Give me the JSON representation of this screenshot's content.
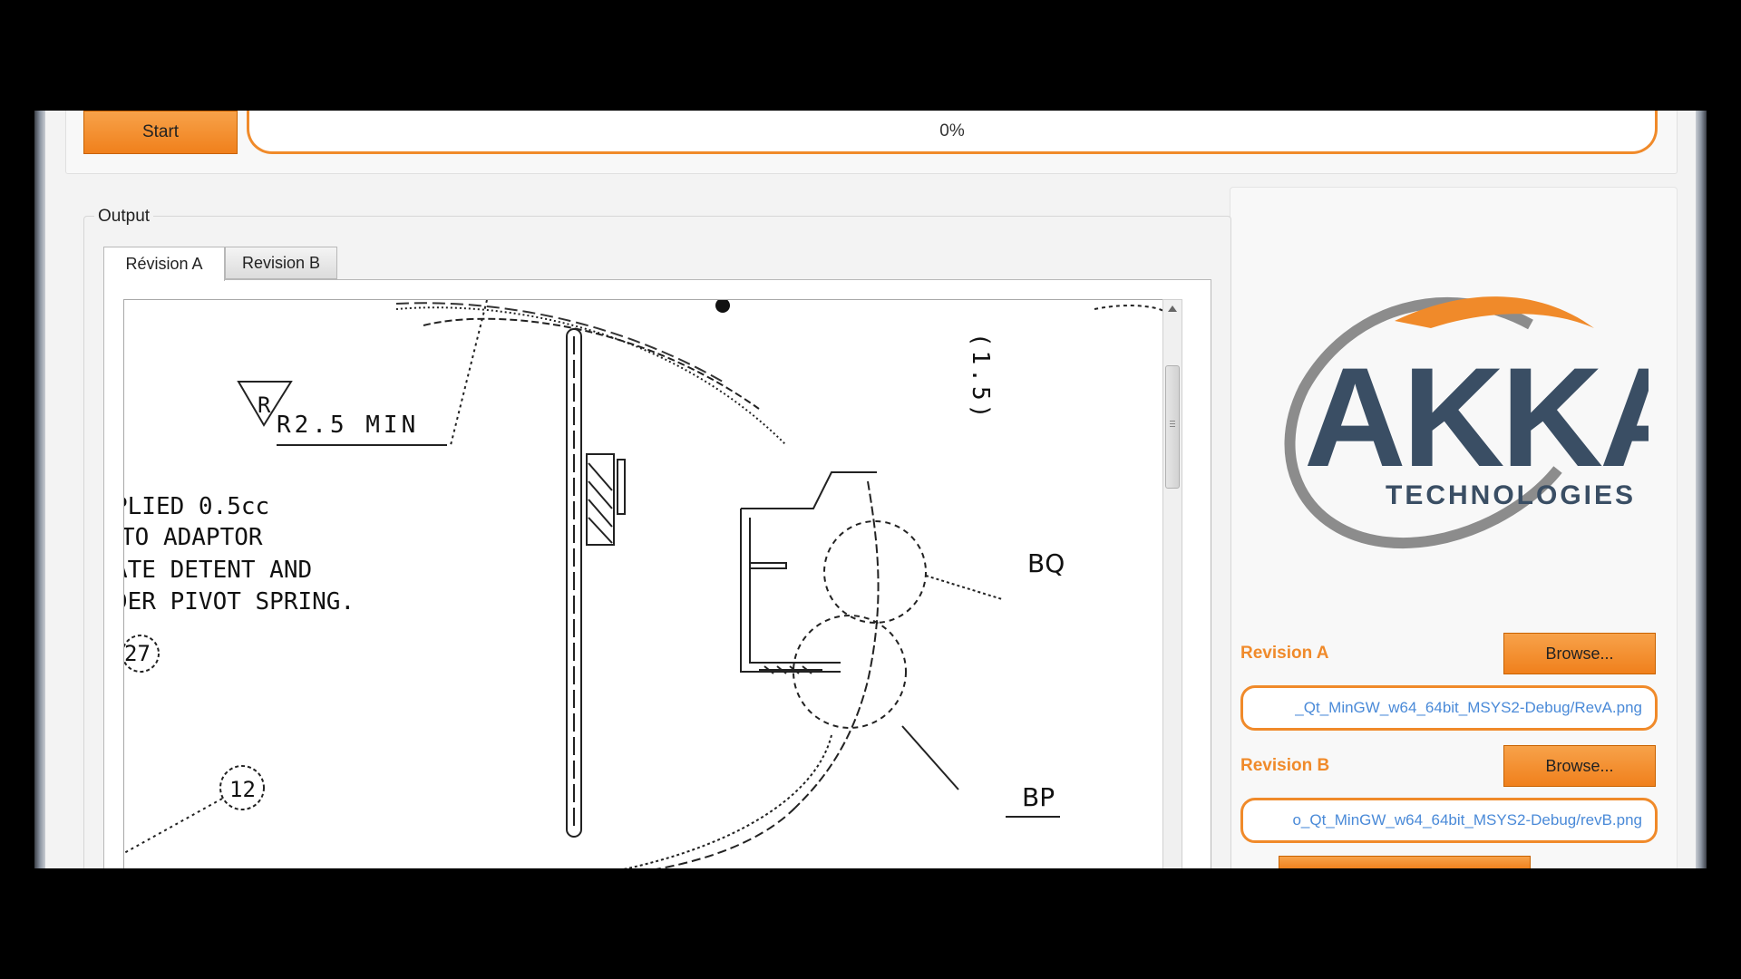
{
  "toolbar": {
    "start_label": "Start",
    "progress_text": "0%",
    "progress_value": 0
  },
  "output": {
    "title": "Output",
    "tabs": [
      {
        "label": "Révision A",
        "selected": true
      },
      {
        "label": "Revision B",
        "selected": false
      }
    ],
    "drawing_text": {
      "r_symbol": "R",
      "min_label": "R2.5 MIN",
      "note_line1": "PLIED 0.5cc",
      "note_line2": "TO ADAPTOR",
      "note_line3": "ATE DETENT AND",
      "note_line4": "DER PIVOT SPRING.",
      "dim": "(1.5)",
      "balloon_27": "27",
      "balloon_12": "12",
      "callout_bq": "BQ",
      "callout_bp": "BP"
    }
  },
  "logo": {
    "brand": "AKKA",
    "subtitle": "TECHNOLOGIES",
    "colors": {
      "primary": "#3a4e64",
      "accent": "#f08a2a",
      "swoosh": "#8c8c8c"
    }
  },
  "revision_a": {
    "label": "Revision A",
    "browse_label": "Browse...",
    "path": "_Qt_MinGW_w64_64bit_MSYS2-Debug/RevA.png"
  },
  "revision_b": {
    "label": "Revision B",
    "browse_label": "Browse...",
    "path": "o_Qt_MinGW_w64_64bit_MSYS2-Debug/revB.png"
  },
  "colors": {
    "accent": "#f08a2a",
    "path_text": "#4a8ad8"
  }
}
